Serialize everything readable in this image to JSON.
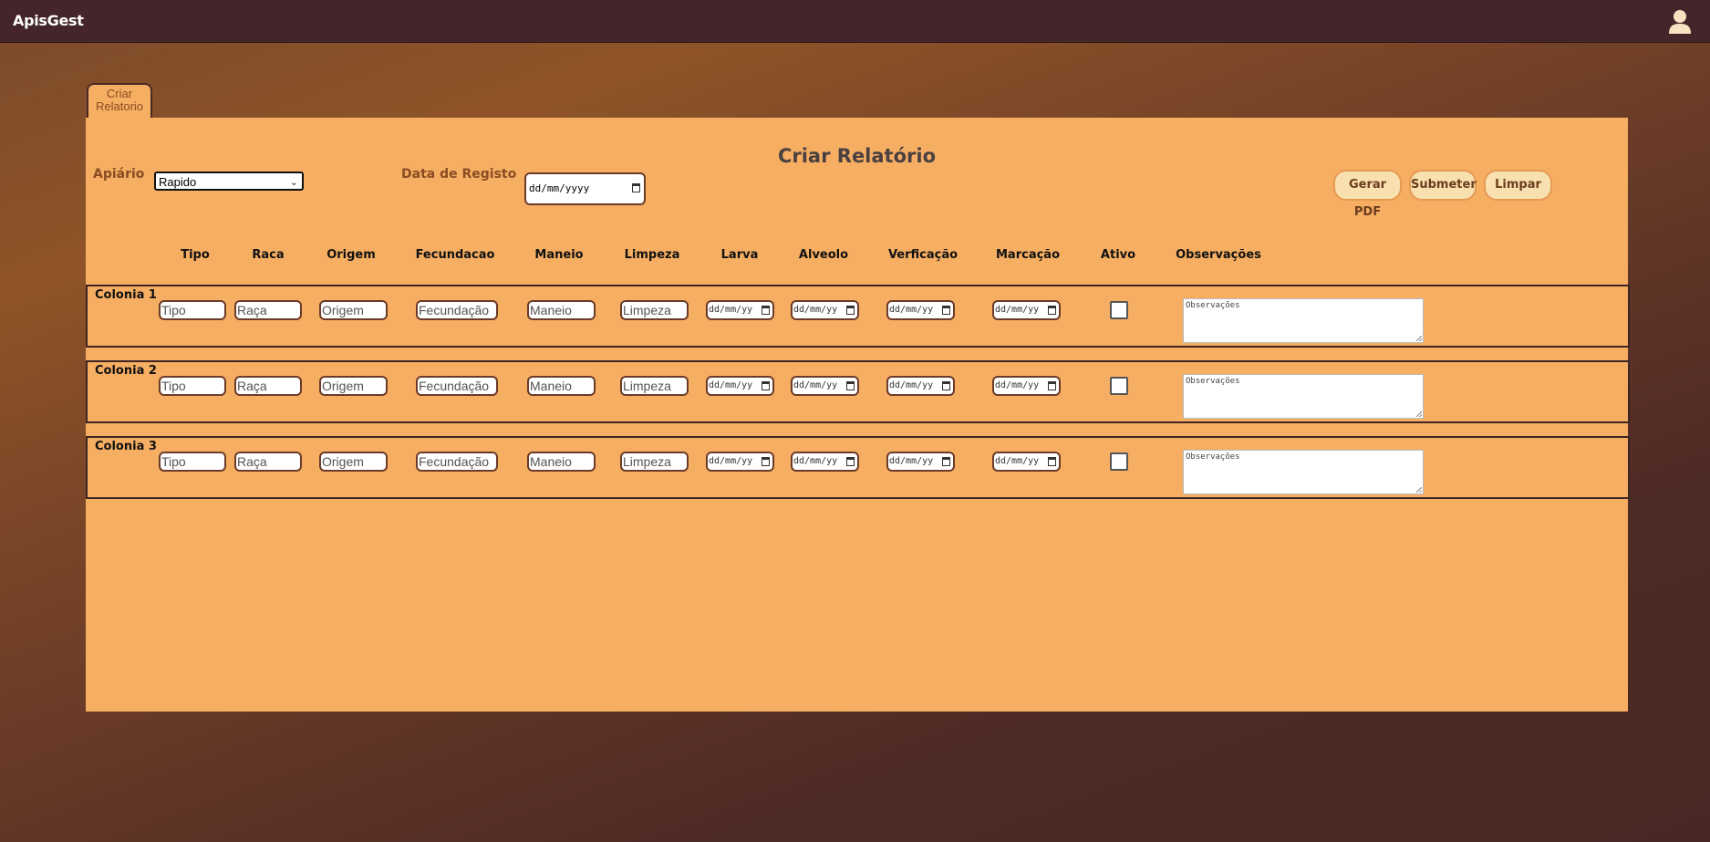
{
  "app": {
    "brand": "ApisGest"
  },
  "tab": {
    "label": "Criar Relatorio"
  },
  "form": {
    "title": "Criar Relatório",
    "apiario_label": "Apiário",
    "apiario_value": "Rapido",
    "data_label": "Data de Registo",
    "data_placeholder": "dd/mm/yyyy"
  },
  "buttons": {
    "pdf": "Gerar PDF",
    "submit": "Submeter",
    "clear": "Limpar"
  },
  "columns": [
    "Tipo",
    "Raca",
    "Origem",
    "Fecundacao",
    "Maneio",
    "Limpeza",
    "Larva",
    "Alveolo",
    "Verficação",
    "Marcação",
    "Ativo",
    "Observações"
  ],
  "row_placeholders": {
    "tipo": "Tipo",
    "raca": "Raça",
    "origem": "Origem",
    "fecundacao": "Fecundação",
    "maneio": "Maneio",
    "limpeza": "Limpeza",
    "date": "dd/mm/yy",
    "obs": "Observações"
  },
  "rows": [
    {
      "name": "Colonia 1"
    },
    {
      "name": "Colonia 2"
    },
    {
      "name": "Colonia 3"
    }
  ]
}
